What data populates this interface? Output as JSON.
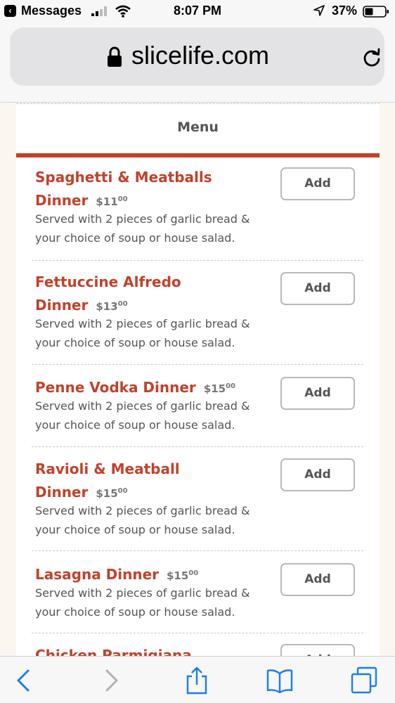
{
  "status_bar": {
    "back_app": "Messages",
    "time": "8:07 PM",
    "battery_pct": "37%"
  },
  "browser": {
    "url": "slicelife.com"
  },
  "menu": {
    "title": "Menu",
    "add_label": "Add",
    "items": [
      {
        "name_line1": "Spaghetti & Meatballs",
        "name_line2": "Dinner",
        "price_main": "$11",
        "price_cents": "00",
        "desc_line1": "Served with 2 pieces of garlic bread &",
        "desc_line2": "your choice of soup or house salad."
      },
      {
        "name_line1": "Fettuccine Alfredo",
        "name_line2": "Dinner",
        "price_main": "$13",
        "price_cents": "00",
        "desc_line1": "Served with 2 pieces of garlic bread &",
        "desc_line2": "your choice of soup or house salad."
      },
      {
        "name_line1": "Penne Vodka Dinner",
        "price_main": "$15",
        "price_cents": "00",
        "desc_line1": "Served with 2 pieces of garlic bread &",
        "desc_line2": "your choice of soup or house salad."
      },
      {
        "name_line1": "Ravioli & Meatball",
        "name_line2": "Dinner",
        "price_main": "$15",
        "price_cents": "00",
        "desc_line1": "Served with 2 pieces of garlic bread &",
        "desc_line2": "your choice of soup or house salad."
      },
      {
        "name_line1": "Lasagna Dinner",
        "price_main": "$15",
        "price_cents": "00",
        "desc_line1": "Served with 2 pieces of garlic bread &",
        "desc_line2": "your choice of soup or house salad."
      },
      {
        "name_line1": "Chicken Parmigiana"
      }
    ]
  },
  "colors": {
    "accent": "#c2412b",
    "ios_blue": "#1a7cf5"
  },
  "toolbar": {
    "icons": [
      "back-icon",
      "forward-icon",
      "share-icon",
      "bookmarks-icon",
      "tabs-icon"
    ]
  }
}
